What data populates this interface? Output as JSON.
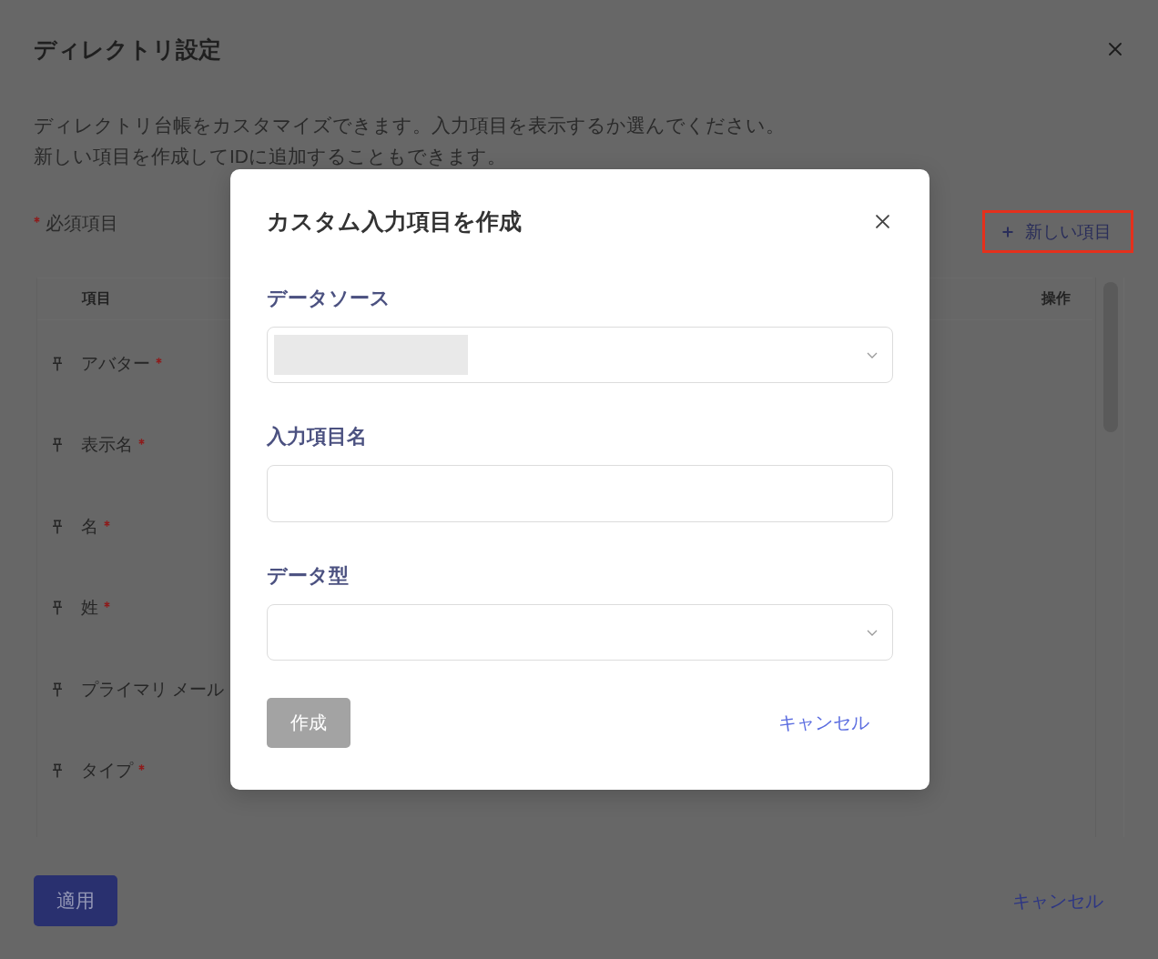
{
  "window": {
    "title": "ディレクトリ設定"
  },
  "description": [
    "ディレクトリ台帳をカスタマイズできます。入力項目を表示するか選んでください。",
    "新しい項目を作成してIDに追加することもできます。"
  ],
  "required_note": {
    "label": "必須項目"
  },
  "new_item_button": {
    "label": "新しい項目",
    "highlighted": true
  },
  "table": {
    "columns": [
      "項目",
      "操作"
    ],
    "rows": [
      {
        "label": "アバター",
        "required": true
      },
      {
        "label": "表示名",
        "required": true
      },
      {
        "label": "名",
        "required": true
      },
      {
        "label": "姓",
        "required": true
      },
      {
        "label": "プライマリ メール",
        "required": false
      },
      {
        "label": "タイプ",
        "required": true
      }
    ]
  },
  "footer": {
    "apply_button": {
      "label": "適用"
    },
    "cancel_link": {
      "label": "キャンセル"
    }
  },
  "dialog": {
    "title": "カスタム入力項目を作成",
    "fields": [
      {
        "kind": "select",
        "label": "データソース",
        "loading": true
      },
      {
        "kind": "text",
        "label": "入力項目名",
        "loading": false
      },
      {
        "kind": "select",
        "label": "データ型",
        "loading": false
      }
    ],
    "create_button": {
      "label": "作成",
      "disabled": true
    },
    "cancel_link": {
      "label": "キャンセル"
    }
  }
}
